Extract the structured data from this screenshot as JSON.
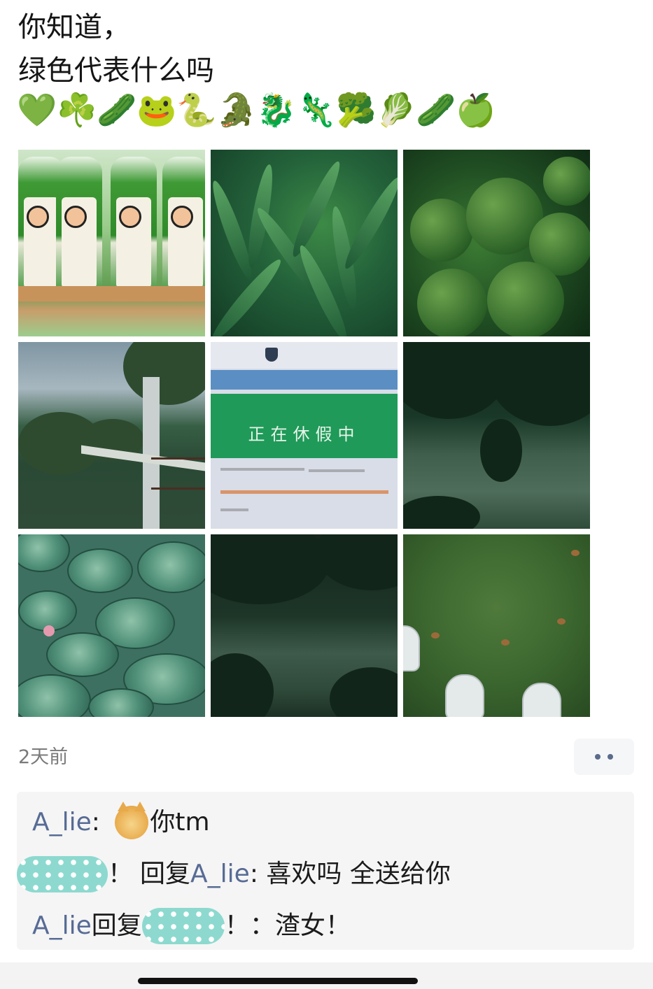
{
  "post": {
    "text_line_1": "你知道，",
    "text_line_2": "绿色代表什么吗",
    "emojis": [
      "💚",
      "☘️",
      "🥒",
      "🐸",
      "🐍",
      "🐊",
      "🐉",
      "🦎",
      "🥦",
      "🥬",
      "🥒",
      "🍏"
    ],
    "photos": [
      {
        "icon": "milk-tea-bottles-photo"
      },
      {
        "icon": "leafy-greens-photo"
      },
      {
        "icon": "broccoli-photo"
      },
      {
        "icon": "bridge-photo"
      },
      {
        "icon": "screen-photo",
        "screen_text": "正在休假中"
      },
      {
        "icon": "dark-river-photo"
      },
      {
        "icon": "lotus-leaves-photo"
      },
      {
        "icon": "dark-pond-photo"
      },
      {
        "icon": "grass-shoes-photo"
      }
    ],
    "time_ago": "2天前"
  },
  "comments": [
    {
      "user": "A_lie",
      "separator": ": ",
      "text": "你tm",
      "emoji": "cat-face"
    },
    {
      "user_hidden": true,
      "suffix": "！",
      "reply_word": "回复",
      "reply_to": "A_lie",
      "separator": ": ",
      "text": "喜欢吗 全送给你"
    },
    {
      "user": "A_lie",
      "reply_word": "回复",
      "reply_to_hidden": true,
      "suffix": "！",
      "separator": "：",
      "text": "渣女！"
    }
  ],
  "colors": {
    "link": "#576b95",
    "comment_bg": "#f5f5f5",
    "redaction": "#8dd9cf"
  }
}
